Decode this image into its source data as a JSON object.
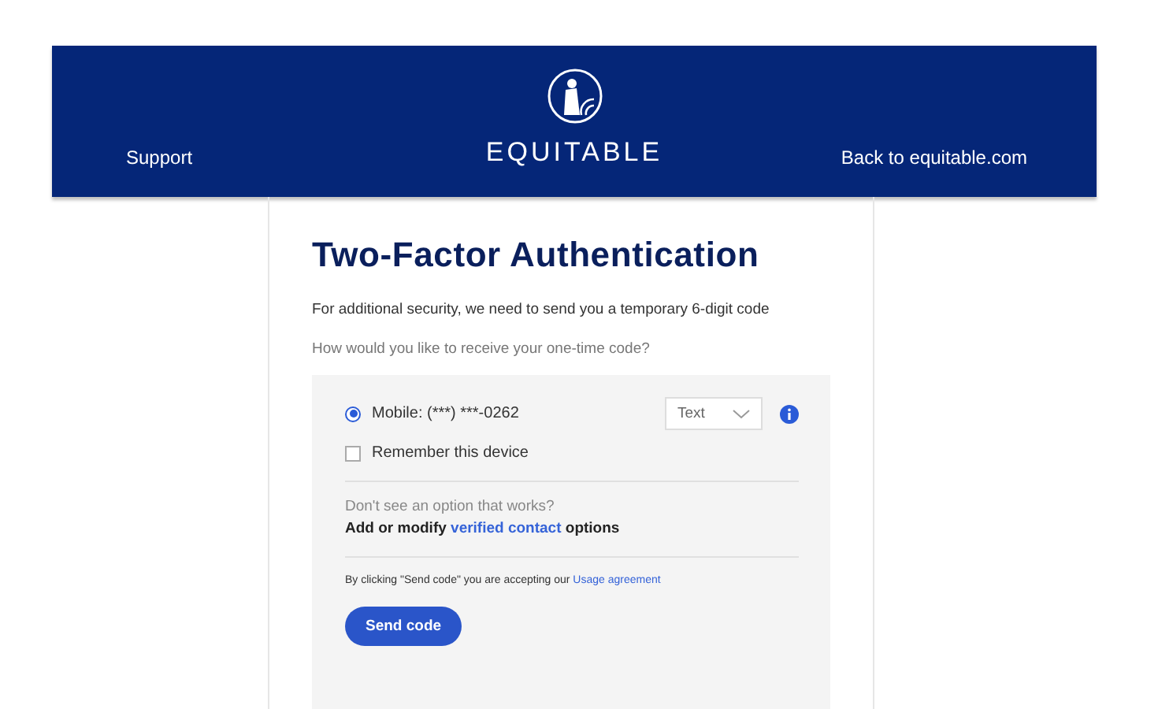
{
  "header": {
    "left_link": "Support",
    "brand": "EQUITABLE",
    "right_link": "Back to equitable.com"
  },
  "title": "Two-Factor Authentication",
  "intro": "For additional security, we need to send you a temporary 6-digit code",
  "question": "How would you like to receive your one-time code?",
  "options": [
    {
      "label": "Mobile: (***) ***-0262",
      "selected": true,
      "method": "Text"
    }
  ],
  "remember": {
    "label": "Remember this device",
    "checked": false
  },
  "help": {
    "question": "Don't see an option that works?",
    "prefix": "Add or modify",
    "link": "verified contact",
    "suffix": "options"
  },
  "agreement": {
    "prefix": "By clicking \"Send code\" you are accepting our",
    "link": "Usage agreement"
  },
  "send_button": "Send code"
}
